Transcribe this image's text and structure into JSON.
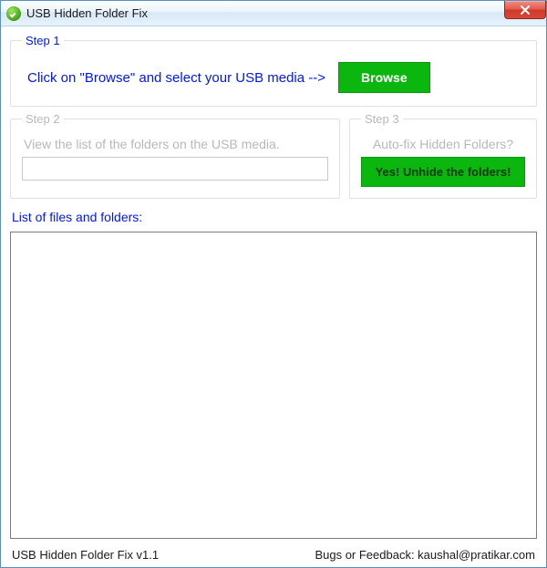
{
  "window": {
    "title": "USB Hidden Folder Fix"
  },
  "step1": {
    "legend": "Step 1",
    "instruction": "Click on \"Browse\" and select your USB media -->",
    "browse_label": "Browse"
  },
  "step2": {
    "legend": "Step 2",
    "instruction": "View the list of the folders on the USB media.",
    "path_value": ""
  },
  "step3": {
    "legend": "Step 3",
    "question": "Auto-fix Hidden Folders?",
    "unhide_label": "Yes! Unhide the folders!"
  },
  "list": {
    "label": "List of files and folders:",
    "items": []
  },
  "status": {
    "left": "USB Hidden Folder Fix v1.1",
    "right": "Bugs or Feedback: kaushal@pratikar.com"
  }
}
